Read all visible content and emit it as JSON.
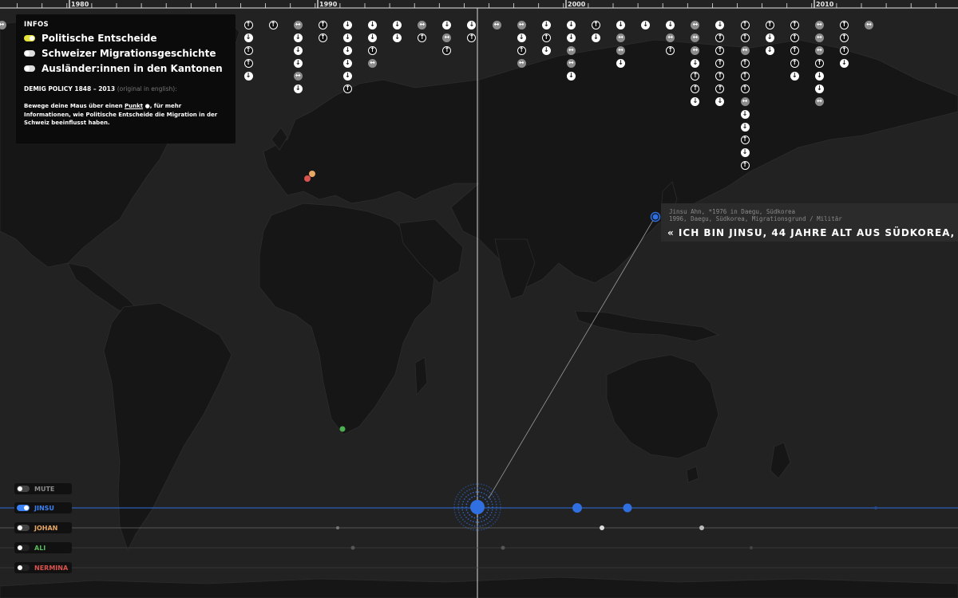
{
  "timeline": {
    "year_labels": [
      "1980",
      "1990",
      "2000",
      "2010"
    ]
  },
  "policy_columns": [
    [
      "both"
    ],
    [
      "up",
      "down",
      "up",
      "up",
      "down"
    ],
    [
      "up"
    ],
    [
      "both",
      "down",
      "down",
      "down",
      "both",
      "down"
    ],
    [
      "up",
      "up"
    ],
    [
      "down",
      "down",
      "down",
      "down",
      "down",
      "up"
    ],
    [
      "down",
      "down",
      "up",
      "both"
    ],
    [
      "down",
      "down"
    ],
    [
      "both",
      "up"
    ],
    [
      "down",
      "both",
      "up"
    ],
    [
      "down",
      "up"
    ],
    [
      "both"
    ],
    [
      "both",
      "down",
      "up",
      "both"
    ],
    [
      "down",
      "up",
      "down"
    ],
    [
      "down",
      "down",
      "both",
      "both",
      "down"
    ],
    [
      "up",
      "down"
    ],
    [
      "down",
      "both",
      "both",
      "down"
    ],
    [
      "down"
    ],
    [
      "down",
      "both",
      "up"
    ],
    [
      "both",
      "both",
      "both",
      "down",
      "up",
      "up",
      "down"
    ],
    [
      "down",
      "up",
      "up",
      "up",
      "up",
      "up",
      "down"
    ],
    [
      "up",
      "up",
      "both",
      "up",
      "up",
      "up",
      "both",
      "down",
      "down",
      "up",
      "down",
      "up"
    ],
    [
      "up",
      "down",
      "down"
    ],
    [
      "up",
      "up",
      "up",
      "up",
      "down"
    ],
    [
      "both",
      "both",
      "both",
      "up",
      "down",
      "down",
      "both"
    ],
    [
      "up",
      "up",
      "up",
      "down"
    ],
    [
      "both"
    ]
  ],
  "info": {
    "title": "INFOS",
    "layers": [
      {
        "label": "Politische Entscheide",
        "state": "on-yellow"
      },
      {
        "label": "Schweizer Migrationsgeschichte",
        "state": "off"
      },
      {
        "label": "Ausländer:innen in den Kantonen",
        "state": "off"
      }
    ],
    "policy_heading": "DEMIG POLICY 1848 – 2013",
    "policy_note": "(original in english):",
    "desc_1": "Bewege deine Maus über einen ",
    "desc_link": "Punkt",
    "desc_symbol": " ●",
    "desc_2": ", für mehr Informationen, wie Politische Entscheide die Migration in der Schweiz beeinflusst haben."
  },
  "person_card": {
    "meta_line1": "Jinsu Ahn, *1976 in Daegu, Südkorea",
    "meta_line2": "1996, Daegu, Südkorea, Migrationsgrund / Militär",
    "quote": "« ICH BIN JINSU, 44 JAHRE ALT AUS SÜDKOREA,"
  },
  "persons": [
    {
      "label": "MUTE",
      "color": "#8a8a8a",
      "switch": "#444444",
      "knob": "left"
    },
    {
      "label": "JINSU",
      "color": "#3b82f6",
      "switch": "#3b82f6",
      "knob": "right"
    },
    {
      "label": "JOHAN",
      "color": "#e8a865",
      "switch": "#444444",
      "knob": "left"
    },
    {
      "label": "ALI",
      "color": "#5cb85c",
      "switch": "#222222",
      "knob": "left"
    },
    {
      "label": "NERMINA",
      "color": "#d9534f",
      "switch": "#222222",
      "knob": "left"
    }
  ],
  "colors": {
    "jinsu": "#2f6fe0",
    "johan_marker": "#e8a865",
    "nermina_marker": "#d9534f",
    "ali_marker": "#4caf50",
    "policy_accent": "#e6e23a"
  }
}
